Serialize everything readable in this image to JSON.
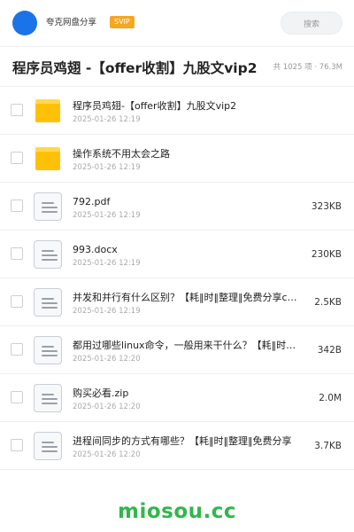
{
  "header": {
    "username": "夸克网盘分享",
    "badge": "SVIP",
    "search_placeholder": "搜索"
  },
  "folder": {
    "title": "程序员鸡翅 -【offer收割】九股文vip2",
    "meta": "共 1025 项 · 76.3M"
  },
  "items": [
    {
      "type": "folder",
      "name": "程序员鸡翅-【offer收割】九股文vip2",
      "date": "2025-01-26 12:19",
      "size": ""
    },
    {
      "type": "folder",
      "name": "操作系统不用太会之路",
      "date": "2025-01-26 12:19",
      "size": ""
    },
    {
      "type": "file",
      "name": "792.pdf",
      "date": "2025-01-26 12:19",
      "size": "323KB"
    },
    {
      "type": "file",
      "name": "993.docx",
      "date": "2025-01-26 12:19",
      "size": "230KB"
    },
    {
      "type": "file",
      "name": "并发和并行有什么区别？【耗‖时‖整理‖免费分享c…",
      "date": "2025-01-26 12:19",
      "size": "2.5KB"
    },
    {
      "type": "file",
      "name": "都用过哪些linux命令，一般用来干什么？【耗‖时…",
      "date": "2025-01-26 12:20",
      "size": "342B"
    },
    {
      "type": "file",
      "name": "购买必看.zip",
      "date": "2025-01-26 12:20",
      "size": "2.0M"
    },
    {
      "type": "file",
      "name": "进程间同步的方式有哪些？【耗‖时‖整理‖免费分享",
      "date": "2025-01-26 12:20",
      "size": "3.7KB"
    }
  ],
  "footer": {
    "watermark": "miosou.cc"
  },
  "colors": {
    "avatar": "#1a73e8",
    "badge": "#f5a623",
    "folder": "#ffc107",
    "watermark": "#2fb84a"
  }
}
